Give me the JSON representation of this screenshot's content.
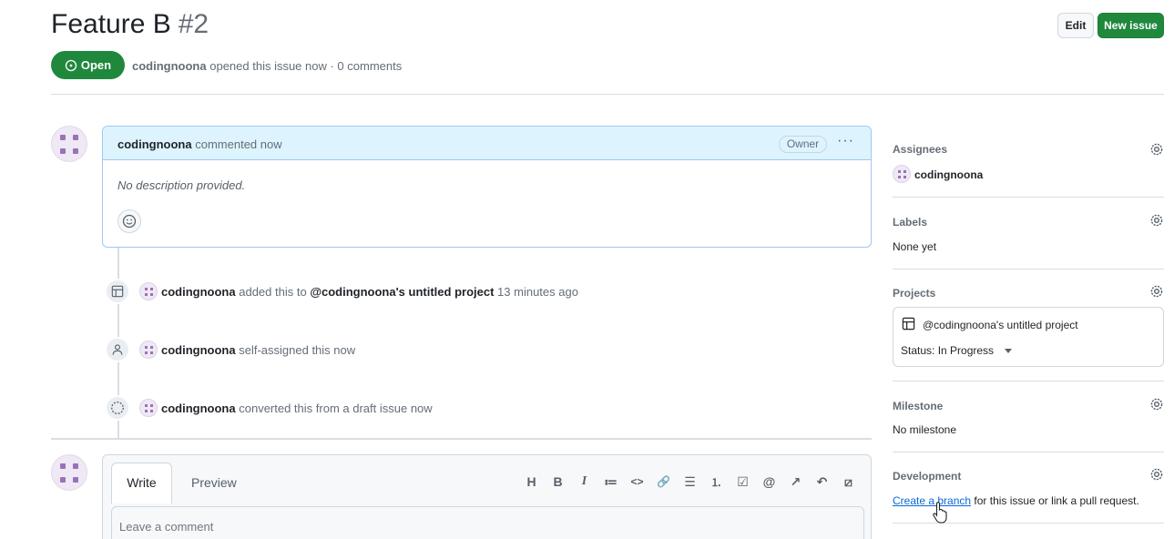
{
  "header": {
    "title": "Feature B",
    "number": "#2",
    "edit_label": "Edit",
    "new_issue_label": "New issue",
    "state_label": "Open",
    "author": "codingnoona",
    "meta_text": "opened this issue now · 0 comments"
  },
  "comment": {
    "author": "codingnoona",
    "action": "commented now",
    "badge": "Owner",
    "menu": "···",
    "body": "No description provided."
  },
  "timeline": [
    {
      "icon": "project-table-icon",
      "actor": "codingnoona",
      "text_pre": "added this to",
      "target": "@codingnoona's untitled project",
      "text_post": "13 minutes ago"
    },
    {
      "icon": "person-icon",
      "actor": "codingnoona",
      "text_pre": "self-assigned this now"
    },
    {
      "icon": "draft-circle-icon",
      "actor": "codingnoona",
      "text_pre": "converted this from a draft issue now"
    }
  ],
  "compose": {
    "tab_write": "Write",
    "tab_preview": "Preview",
    "placeholder": "Leave a comment",
    "tools": [
      "H",
      "B",
      "I",
      "≔",
      "<>",
      "🔗",
      "☰",
      "⒈",
      "☑",
      "@",
      "↗",
      "↶",
      "⧄"
    ]
  },
  "sidebar": {
    "assignees_label": "Assignees",
    "assignee_name": "codingnoona",
    "labels_label": "Labels",
    "labels_value": "None yet",
    "projects_label": "Projects",
    "project_name": "@codingnoona's untitled project",
    "project_status": "Status: In Progress",
    "milestone_label": "Milestone",
    "milestone_value": "No milestone",
    "development_label": "Development",
    "development_link": "Create a branch",
    "development_rest": "for this issue or link a pull request."
  },
  "colors": {
    "open_green": "#1f883d",
    "comment_header_blue": "#ddf4ff",
    "link_blue": "#0969da",
    "avatar_purple": "#9a72b6"
  }
}
